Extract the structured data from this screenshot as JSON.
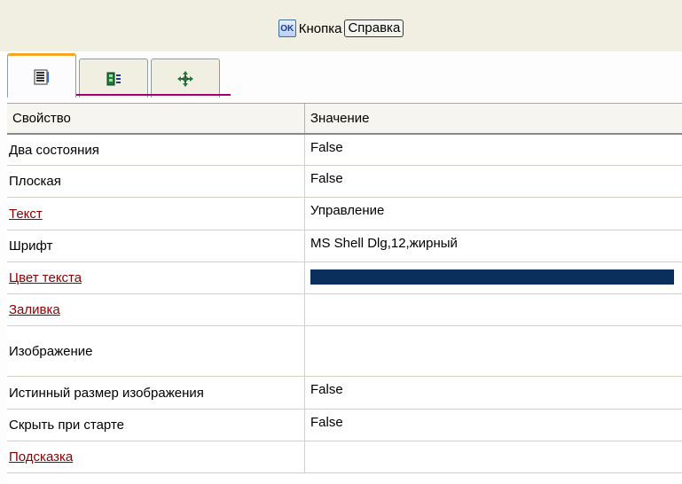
{
  "title": {
    "ok_icon": "ok-button-icon",
    "ok_text": "OK",
    "label": "Кнопка",
    "help_button": "Справка"
  },
  "tabs": [
    {
      "icon": "properties-list-icon",
      "active": true
    },
    {
      "icon": "events-icon",
      "active": false
    },
    {
      "icon": "layout-move-icon",
      "active": false
    }
  ],
  "grid": {
    "headers": [
      "Свойство",
      "Значение"
    ],
    "rows": [
      {
        "name": "Два состояния",
        "value": "False",
        "link": false
      },
      {
        "name": "Плоская",
        "value": "False",
        "link": false
      },
      {
        "name": "Текст",
        "value": "Управление",
        "link": true
      },
      {
        "name": "Шрифт",
        "value": "MS Shell Dlg,12,жирный",
        "link": false
      },
      {
        "name": "Цвет текста",
        "value": "",
        "link": true,
        "color": "#0a2f5c"
      },
      {
        "name": "Заливка",
        "value": "",
        "link": true
      },
      {
        "name": "Изображение",
        "value": "",
        "link": false
      },
      {
        "name": "Истинный размер изображения",
        "value": "False",
        "link": false
      },
      {
        "name": "Скрыть при старте",
        "value": "False",
        "link": false
      },
      {
        "name": "Подсказка",
        "value": "",
        "link": true
      }
    ]
  },
  "colors": {
    "header_bg": "#f1efe2",
    "active_tab_accent": "#f5a623",
    "link": "#8b0000",
    "text_color_swatch": "#0a2f5c"
  }
}
